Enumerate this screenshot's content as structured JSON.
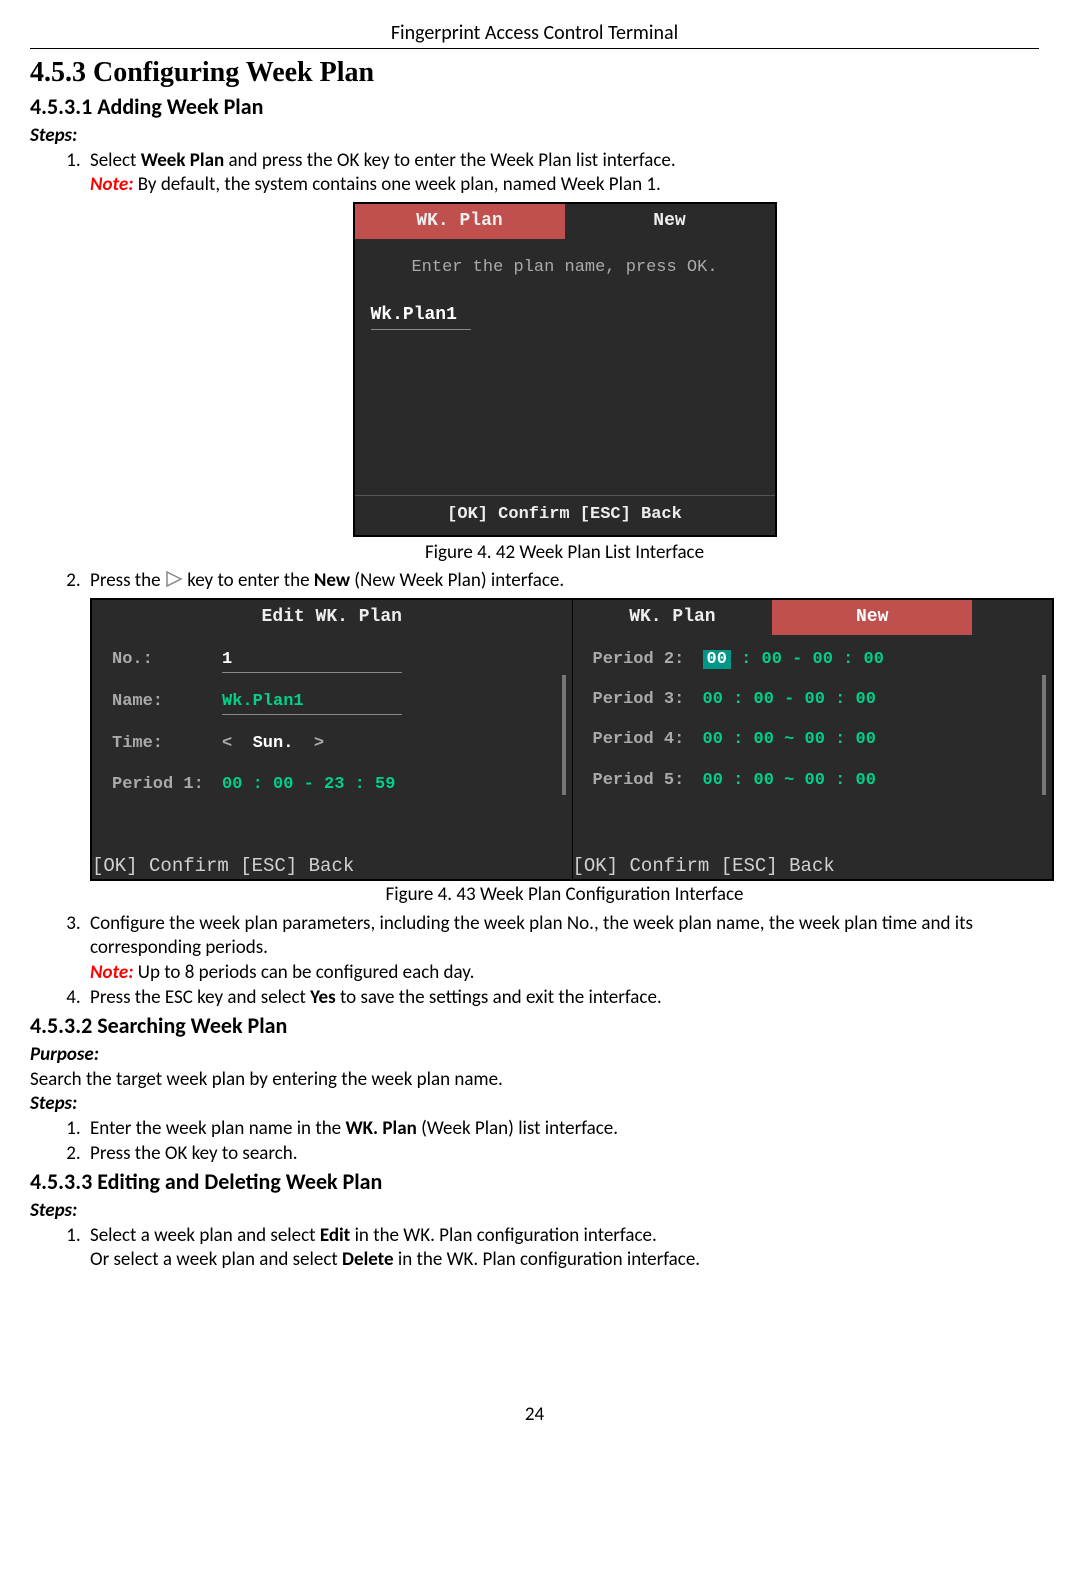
{
  "header": "Fingerprint Access Control Terminal",
  "h1": "4.5.3   Configuring Week Plan",
  "h2a": "4.5.3.1 Adding Week Plan",
  "steps_label": "Steps:",
  "purpose_label": "Purpose:",
  "step_a1_pre": "Select ",
  "step_a1_bold": "Week Plan",
  "step_a1_post": " and press the OK key to enter the Week Plan list interface.",
  "note_label": "Note:",
  "note_a1": " By default, the system contains one week plan, named Week Plan 1.",
  "fig42_caption": "Figure 4. 42 Week Plan List Interface",
  "step_a2_pre": "Press the ",
  "step_a2_post": " key to enter the ",
  "step_a2_bold": "New",
  "step_a2_post2": " (New Week Plan) interface.",
  "fig43_caption": "Figure 4. 43 Week Plan Configuration Interface",
  "step_a3": "Configure the week plan parameters, including the week plan No., the week plan name, the week plan time and its corresponding periods.",
  "note_a3": " Up to 8 periods can be configured each day.",
  "step_a4_pre": "Press the ESC key and select ",
  "step_a4_bold": "Yes",
  "step_a4_post": " to save the settings and exit the interface.",
  "h2b": "4.5.3.2 Searching Week Plan",
  "purpose_text": "Search the target week plan by entering the week plan name.",
  "step_b1_pre": "Enter the week plan name in the ",
  "step_b1_bold": "WK. Plan",
  "step_b1_post": " (Week Plan) list interface.",
  "step_b2": "Press the OK key to search.",
  "h2c": "4.5.3.3 Editing and Deleting Week Plan",
  "step_c1_pre": "Select a week plan and select ",
  "step_c1_bold": "Edit",
  "step_c1_post": " in the WK. Plan configuration interface.",
  "step_c1b_pre": "Or select a week plan and select ",
  "step_c1b_bold": "Delete",
  "step_c1b_post": " in the WK. Plan configuration interface.",
  "page_num": "24",
  "term1": {
    "tab_plan": "WK. Plan",
    "tab_new": "New",
    "explain": "Enter the plan name, press OK.",
    "plan_name": "Wk.Plan1",
    "footer": "[OK] Confirm   [ESC] Back"
  },
  "term2a": {
    "title": "Edit WK. Plan",
    "no_lbl": "No.:",
    "no_val": "1",
    "name_lbl": "Name:",
    "name_val": "Wk.Plan1",
    "time_lbl": "Time:",
    "time_val": "Sun.",
    "period1_lbl": "Period 1:",
    "period1_val": "00 : 00 - 23 : 59",
    "footer": "[OK] Confirm   [ESC] Back"
  },
  "term2b": {
    "tab_plan": "WK. Plan",
    "tab_new": "New",
    "p2_lbl": "Period 2:",
    "p2_val_hl": "00",
    "p2_val_rest": " : 00 - 00 : 00",
    "p3_lbl": "Period 3:",
    "p3_val": "00 : 00 - 00 : 00",
    "p4_lbl": "Period 4:",
    "p4_val": "00 : 00 ~ 00 : 00",
    "p5_lbl": "Period 5:",
    "p5_val": "00 : 00 ~ 00 : 00",
    "footer": "[OK] Confirm   [ESC] Back"
  }
}
